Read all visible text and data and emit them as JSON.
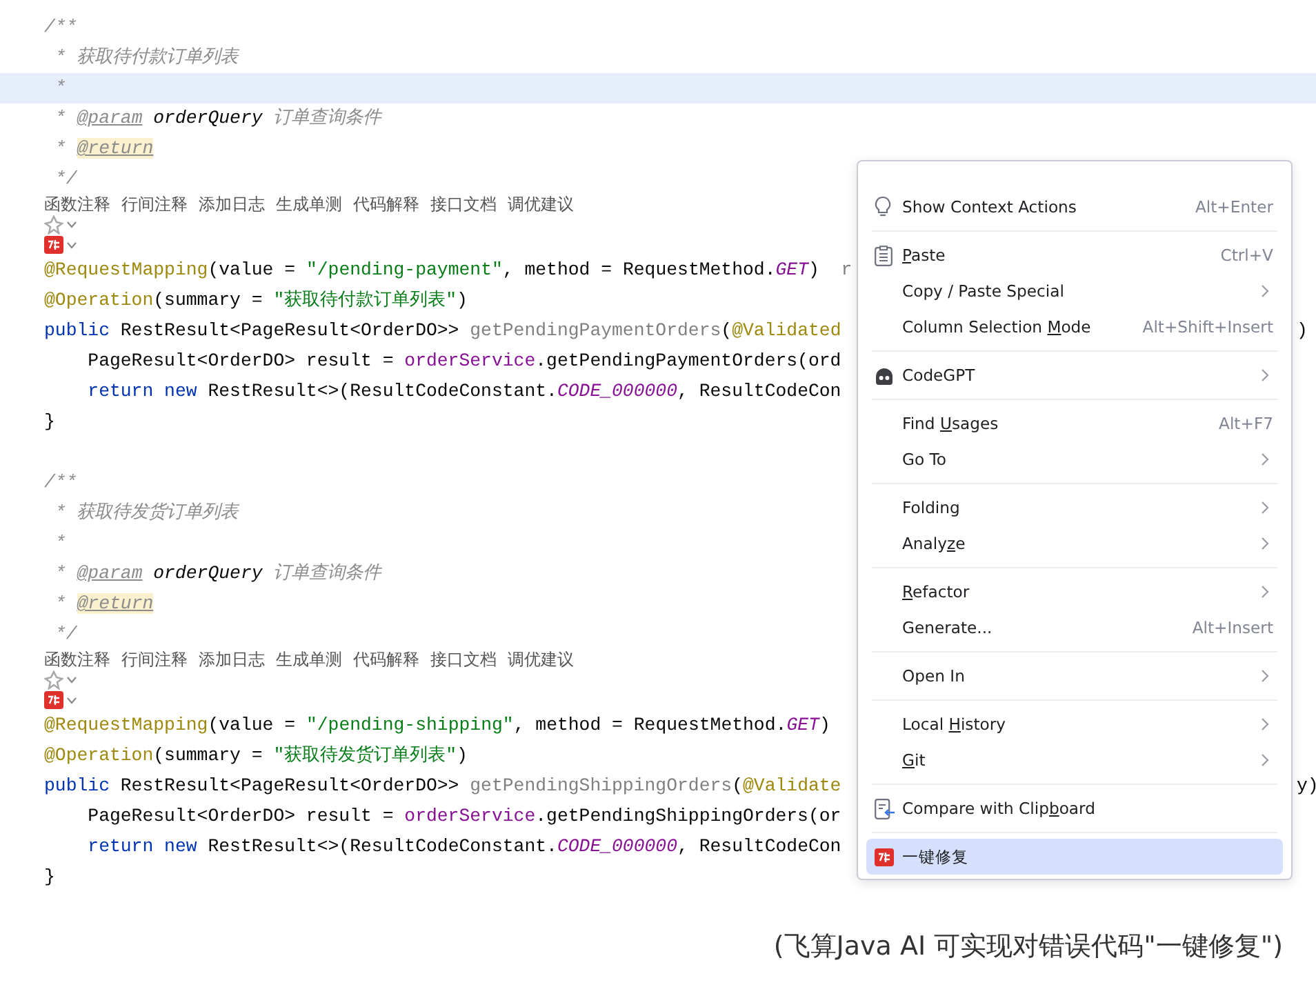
{
  "blocks": [
    {
      "doc": [
        {
          "current": false,
          "tokens": [
            {
              "kind": "comment",
              "text": "/**"
            }
          ]
        },
        {
          "current": false,
          "tokens": [
            {
              "kind": "comment",
              "text": " * 获取待付款订单列表"
            }
          ]
        },
        {
          "current": true,
          "tokens": [
            {
              "kind": "comment",
              "text": " *"
            }
          ]
        },
        {
          "current": false,
          "tokens": [
            {
              "kind": "comment",
              "text": " * "
            },
            {
              "kind": "doctag",
              "text": "@param"
            },
            {
              "kind": "param",
              "text": " orderQuery"
            },
            {
              "kind": "comment",
              "text": " 订单查询条件"
            }
          ]
        },
        {
          "current": false,
          "tokens": [
            {
              "kind": "comment",
              "text": " * "
            },
            {
              "kind": "doctag_marked",
              "text": "@return"
            }
          ]
        },
        {
          "current": false,
          "tokens": [
            {
              "kind": "comment",
              "text": " */"
            }
          ]
        }
      ],
      "actions": [
        "函数注释",
        "行间注释",
        "添加日志",
        "生成单测",
        "代码解释",
        "接口文档",
        "调优建议"
      ],
      "code": [
        {
          "current": false,
          "tokens": [
            {
              "kind": "annotation",
              "text": "@RequestMapping"
            },
            {
              "kind": "plain",
              "text": "(value = "
            },
            {
              "kind": "string",
              "text": "\"/pending-payment\""
            },
            {
              "kind": "plain",
              "text": ", method = RequestMethod."
            },
            {
              "kind": "constant",
              "text": "GET"
            },
            {
              "kind": "plain",
              "text": ")"
            },
            {
              "kind": "unused",
              "text": "  r"
            }
          ]
        },
        {
          "current": false,
          "tokens": [
            {
              "kind": "annotation",
              "text": "@Operation"
            },
            {
              "kind": "plain",
              "text": "(summary = "
            },
            {
              "kind": "string",
              "text": "\"获取待付款订单列表\""
            },
            {
              "kind": "plain",
              "text": ")"
            }
          ]
        },
        {
          "current": false,
          "tail": ")",
          "tokens": [
            {
              "kind": "keyword",
              "text": "public"
            },
            {
              "kind": "plain",
              "text": " RestResult<PageResult<OrderDO>> "
            },
            {
              "kind": "unused",
              "text": "getPendingPaymentOrders"
            },
            {
              "kind": "plain",
              "text": "("
            },
            {
              "kind": "annotation",
              "text": "@Validated"
            }
          ]
        },
        {
          "current": false,
          "tokens": [
            {
              "kind": "plain",
              "text": "    PageResult<OrderDO> result = "
            },
            {
              "kind": "field",
              "text": "orderService"
            },
            {
              "kind": "plain",
              "text": ".getPendingPaymentOrders(ord"
            }
          ]
        },
        {
          "current": false,
          "tokens": [
            {
              "kind": "keyword",
              "text": "    return new"
            },
            {
              "kind": "plain",
              "text": " RestResult<>(ResultCodeConstant."
            },
            {
              "kind": "constant",
              "text": "CODE_000000"
            },
            {
              "kind": "plain",
              "text": ", ResultCodeCon"
            }
          ]
        },
        {
          "current": false,
          "tokens": [
            {
              "kind": "plain",
              "text": "}"
            }
          ]
        }
      ]
    },
    {
      "doc": [
        {
          "current": false,
          "tokens": [
            {
              "kind": "comment",
              "text": "/**"
            }
          ]
        },
        {
          "current": false,
          "tokens": [
            {
              "kind": "comment",
              "text": " * 获取待发货订单列表"
            }
          ]
        },
        {
          "current": false,
          "tokens": [
            {
              "kind": "comment",
              "text": " *"
            }
          ]
        },
        {
          "current": false,
          "tokens": [
            {
              "kind": "comment",
              "text": " * "
            },
            {
              "kind": "doctag",
              "text": "@param"
            },
            {
              "kind": "param",
              "text": " orderQuery"
            },
            {
              "kind": "comment",
              "text": " 订单查询条件"
            }
          ]
        },
        {
          "current": false,
          "tokens": [
            {
              "kind": "comment",
              "text": " * "
            },
            {
              "kind": "doctag_marked",
              "text": "@return"
            }
          ]
        },
        {
          "current": false,
          "tokens": [
            {
              "kind": "comment",
              "text": " */"
            }
          ]
        }
      ],
      "actions": [
        "函数注释",
        "行间注释",
        "添加日志",
        "生成单测",
        "代码解释",
        "接口文档",
        "调优建议"
      ],
      "code": [
        {
          "current": false,
          "tokens": [
            {
              "kind": "annotation",
              "text": "@RequestMapping"
            },
            {
              "kind": "plain",
              "text": "(value = "
            },
            {
              "kind": "string",
              "text": "\"/pending-shipping\""
            },
            {
              "kind": "plain",
              "text": ", method = RequestMethod."
            },
            {
              "kind": "constant",
              "text": "GET"
            },
            {
              "kind": "plain",
              "text": ")"
            }
          ]
        },
        {
          "current": false,
          "tokens": [
            {
              "kind": "annotation",
              "text": "@Operation"
            },
            {
              "kind": "plain",
              "text": "(summary = "
            },
            {
              "kind": "string",
              "text": "\"获取待发货订单列表\""
            },
            {
              "kind": "plain",
              "text": ")"
            }
          ]
        },
        {
          "current": false,
          "tail": "y)",
          "tokens": [
            {
              "kind": "keyword",
              "text": "public"
            },
            {
              "kind": "plain",
              "text": " RestResult<PageResult<OrderDO>> "
            },
            {
              "kind": "unused",
              "text": "getPendingShippingOrders"
            },
            {
              "kind": "plain",
              "text": "("
            },
            {
              "kind": "annotation",
              "text": "@Validate"
            }
          ]
        },
        {
          "current": false,
          "tokens": [
            {
              "kind": "plain",
              "text": "    PageResult<OrderDO> result = "
            },
            {
              "kind": "field",
              "text": "orderService"
            },
            {
              "kind": "plain",
              "text": ".getPendingShippingOrders(or"
            }
          ]
        },
        {
          "current": false,
          "tokens": [
            {
              "kind": "keyword",
              "text": "    return new"
            },
            {
              "kind": "plain",
              "text": " RestResult<>(ResultCodeConstant."
            },
            {
              "kind": "constant",
              "text": "CODE_000000"
            },
            {
              "kind": "plain",
              "text": ", ResultCodeCon"
            }
          ]
        },
        {
          "current": false,
          "tokens": [
            {
              "kind": "plain",
              "text": "}"
            }
          ]
        }
      ]
    }
  ],
  "context_menu": {
    "groups": [
      [
        {
          "kind": "bulb",
          "label_before": "Show Context Actions",
          "shortcut": "Alt+Enter",
          "submenu": false,
          "selected": false
        }
      ],
      [
        {
          "kind": "clipboard",
          "mnemonic": "P",
          "label_after": "aste",
          "shortcut": "Ctrl+V",
          "submenu": false,
          "selected": false
        },
        {
          "kind": "plain",
          "label_before": "Copy / Paste Special",
          "submenu": true,
          "selected": false
        },
        {
          "kind": "plain",
          "label_before": "Column Selection ",
          "mnemonic": "M",
          "label_after": "ode",
          "shortcut": "Alt+Shift+Insert",
          "submenu": false,
          "selected": false
        }
      ],
      [
        {
          "kind": "codegpt",
          "label_before": "CodeGPT",
          "submenu": true,
          "selected": false
        }
      ],
      [
        {
          "kind": "plain",
          "label_before": "Find ",
          "mnemonic": "U",
          "label_after": "sages",
          "shortcut": "Alt+F7",
          "submenu": false,
          "selected": false
        },
        {
          "kind": "plain",
          "label_before": "Go To",
          "submenu": true,
          "selected": false
        }
      ],
      [
        {
          "kind": "plain",
          "label_before": "Folding",
          "submenu": true,
          "selected": false
        },
        {
          "kind": "plain",
          "label_before": "Analy",
          "mnemonic": "z",
          "label_after": "e",
          "submenu": true,
          "selected": false
        }
      ],
      [
        {
          "kind": "plain",
          "mnemonic": "R",
          "label_after": "efactor",
          "submenu": true,
          "selected": false
        },
        {
          "kind": "plain",
          "label_before": "Generate...",
          "shortcut": "Alt+Insert",
          "submenu": false,
          "selected": false
        }
      ],
      [
        {
          "kind": "plain",
          "label_before": "Open In",
          "submenu": true,
          "selected": false
        }
      ],
      [
        {
          "kind": "plain",
          "label_before": "Local ",
          "mnemonic": "H",
          "label_after": "istory",
          "submenu": true,
          "selected": false
        },
        {
          "kind": "plain",
          "mnemonic": "G",
          "label_after": "it",
          "submenu": true,
          "selected": false
        }
      ],
      [
        {
          "kind": "compare",
          "label_before": "Compare with Clip",
          "mnemonic": "b",
          "label_after": "oard",
          "submenu": false,
          "selected": false
        }
      ],
      [
        {
          "kind": "plugin",
          "label_before": "一键修复",
          "submenu": false,
          "selected": true
        }
      ]
    ]
  },
  "caption": "(飞算Java AI 可实现对错误代码\"一键修复\")"
}
